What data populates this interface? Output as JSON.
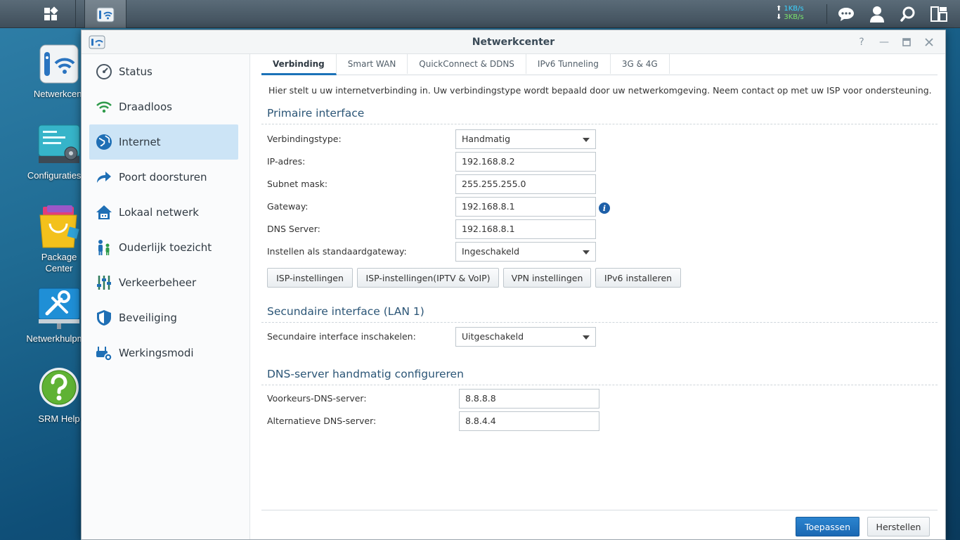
{
  "taskbar": {
    "speed_up": "1KB/s",
    "speed_down": "3KB/s"
  },
  "desktop": {
    "icons": [
      {
        "label": "Netwerkcent"
      },
      {
        "label": "Configuratiesch"
      },
      {
        "label": "Package Center"
      },
      {
        "label": "Netwerkhulpmid"
      },
      {
        "label": "SRM Help"
      }
    ]
  },
  "window": {
    "title": "Netwerkcenter"
  },
  "sidebar": {
    "items": [
      {
        "label": "Status",
        "icon": "gauge-icon"
      },
      {
        "label": "Draadloos",
        "icon": "wifi-icon"
      },
      {
        "label": "Internet",
        "icon": "globe-icon",
        "active": true
      },
      {
        "label": "Poort doorsturen",
        "icon": "forward-arrow-icon"
      },
      {
        "label": "Lokaal netwerk",
        "icon": "house-icon"
      },
      {
        "label": "Ouderlijk toezicht",
        "icon": "family-icon"
      },
      {
        "label": "Verkeerbeheer",
        "icon": "sliders-icon"
      },
      {
        "label": "Beveiliging",
        "icon": "shield-icon"
      },
      {
        "label": "Werkingsmodi",
        "icon": "router-gear-icon"
      }
    ]
  },
  "tabs": [
    {
      "label": "Verbinding",
      "active": true
    },
    {
      "label": "Smart WAN"
    },
    {
      "label": "QuickConnect & DDNS"
    },
    {
      "label": "IPv6 Tunneling"
    },
    {
      "label": "3G & 4G"
    }
  ],
  "intro": "Hier stelt u uw internetverbinding in. Uw verbindingstype wordt bepaald door uw netwerkomgeving. Neem contact op met uw ISP voor ondersteuning.",
  "primary": {
    "title": "Primaire interface",
    "connection_type_label": "Verbindingstype:",
    "connection_type_value": "Handmatig",
    "ip_label": "IP-adres:",
    "ip_value": "192.168.8.2",
    "subnet_label": "Subnet mask:",
    "subnet_value": "255.255.255.0",
    "gateway_label": "Gateway:",
    "gateway_value": "192.168.8.1",
    "dns_label": "DNS Server:",
    "dns_value": "192.168.8.1",
    "default_gw_label": "Instellen als standaardgateway:",
    "default_gw_value": "Ingeschakeld",
    "buttons": {
      "isp": "ISP-instellingen",
      "isp_iptv": "ISP-instellingen(IPTV & VoIP)",
      "vpn": "VPN instellingen",
      "ipv6": "IPv6 installeren"
    }
  },
  "secondary": {
    "title": "Secundaire interface (LAN 1)",
    "enable_label": "Secundaire interface inschakelen:",
    "enable_value": "Uitgeschakeld"
  },
  "dns_manual": {
    "title": "DNS-server handmatig configureren",
    "preferred_label": "Voorkeurs-DNS-server:",
    "preferred_value": "8.8.8.8",
    "alternate_label": "Alternatieve DNS-server:",
    "alternate_value": "8.8.4.4"
  },
  "footer": {
    "apply": "Toepassen",
    "reset": "Herstellen"
  },
  "colors": {
    "accent": "#1b72b8",
    "active_sidebar": "#cce4f6",
    "section_title": "#2b5576"
  }
}
